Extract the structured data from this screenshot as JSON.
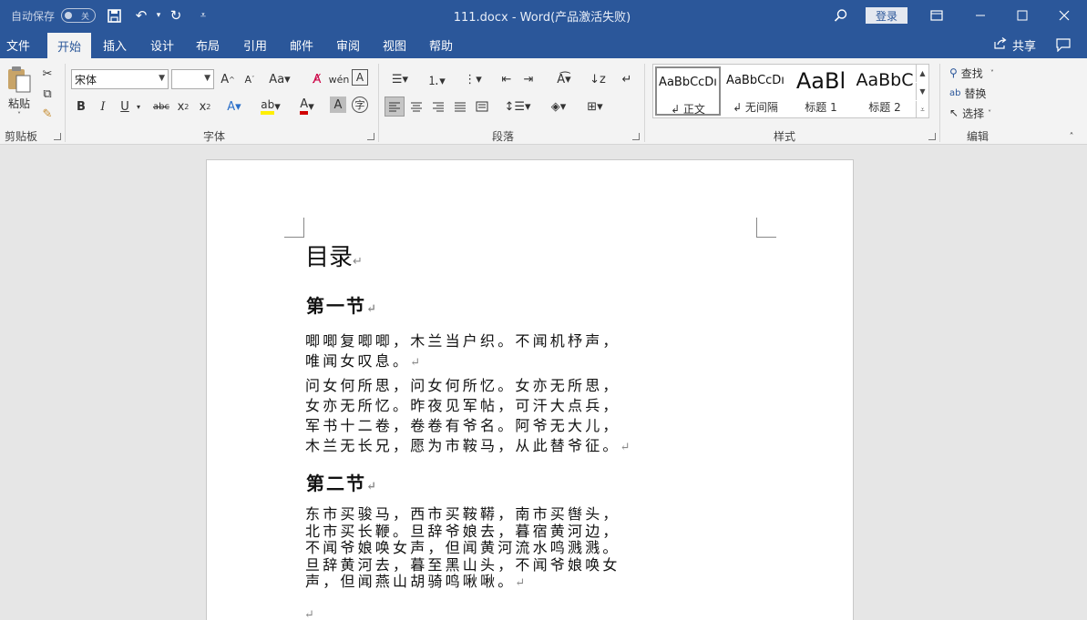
{
  "titlebar": {
    "autosave_label": "自动保存",
    "autosave_state": "关",
    "doc_title": "111.docx  -  Word(产品激活失败)",
    "login": "登录"
  },
  "tabs": [
    "文件",
    "开始",
    "插入",
    "设计",
    "布局",
    "引用",
    "邮件",
    "审阅",
    "视图",
    "帮助"
  ],
  "share_label": "共享",
  "ribbon": {
    "clipboard": {
      "paste": "粘贴",
      "label": "剪贴板"
    },
    "font": {
      "name": "宋体",
      "size": "",
      "label": "字体"
    },
    "paragraph": {
      "label": "段落"
    },
    "styles": {
      "label": "样式",
      "items": [
        {
          "preview": "AaBbCcDı",
          "name": "↲ 正文"
        },
        {
          "preview": "AaBbCcDı",
          "name": "↲ 无间隔"
        },
        {
          "preview": "AaBl",
          "name": "标题 1"
        },
        {
          "preview": "AaBbC",
          "name": "标题 2"
        }
      ]
    },
    "editing": {
      "find": "查找",
      "replace": "替换",
      "select": "选择",
      "label": "编辑"
    }
  },
  "document": {
    "title": "目录",
    "section1": "第一节",
    "p1": [
      "唧唧复唧唧，木兰当户织。不闻机杼声，",
      "唯闻女叹息。"
    ],
    "p2": [
      "问女何所思，问女何所忆。女亦无所思，",
      "女亦无所忆。昨夜见军帖，可汗大点兵，",
      "军书十二卷，卷卷有爷名。阿爷无大儿，",
      "木兰无长兄，愿为市鞍马，从此替爷征。"
    ],
    "section2": "第二节",
    "p3": [
      "东市买骏马，西市买鞍鞯，南市买辔头，",
      "北市买长鞭。旦辞爷娘去，暮宿黄河边，",
      "不闻爷娘唤女声，但闻黄河流水鸣溅溅。",
      "旦辞黄河去，暮至黑山头，不闻爷娘唤女",
      "声，但闻燕山胡骑鸣啾啾。"
    ],
    "para_mark": "↵"
  },
  "colors": {
    "brand": "#2b579a",
    "ribbon_bg": "#f3f3f3",
    "canvas": "#e6e6e6",
    "font_color_red": "#d00000",
    "highlight_yellow": "#ffef00"
  },
  "icons": [
    "save-icon",
    "undo-icon",
    "redo-icon",
    "customize-icon",
    "search-icon",
    "restore-ribbon-icon",
    "minimize-icon",
    "maximize-icon",
    "close-icon",
    "share-icon",
    "comment-icon"
  ]
}
